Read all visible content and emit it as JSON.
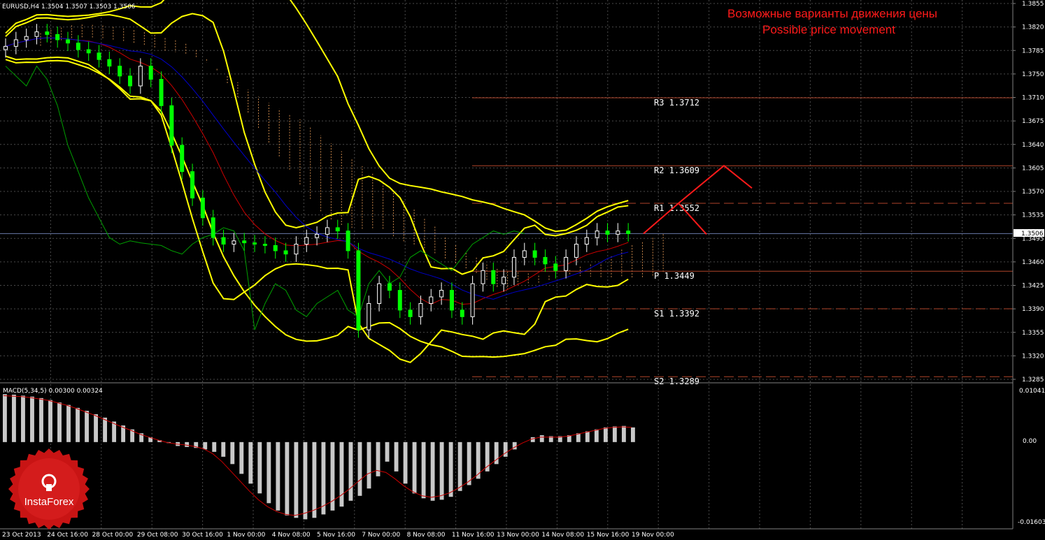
{
  "header": {
    "symbol_info": "EURUSD,H4  1.3504 1.3507 1.3503 1.3506",
    "title_ru": "Возможные варианты движения цены",
    "title_en": "Possible price movement",
    "current_price": "1.3506"
  },
  "macd": {
    "label": "MACD(5,34,5) 0.00300 0.00324",
    "axis_labels": [
      "0.01041",
      "0.00",
      "-0.01603"
    ]
  },
  "logo": {
    "text": "InstaForex"
  },
  "colors": {
    "background": "#000000",
    "grid": "#4a4a4a",
    "bollinger": "#ffff00",
    "kijun": "#cc0000",
    "tenkan": "#0000cc",
    "chikou": "#00a000",
    "cloud": "#c8864a",
    "pivot_lines": "#b0452a",
    "forecast": "#ff1a1a",
    "candle_up": "#ffffff",
    "candle_down": "#00ff00",
    "macd_hist": "#c8c8c8",
    "macd_signal": "#cc0000",
    "current_line": "#6a7aa8"
  },
  "chart_data": {
    "type": "candlestick",
    "instrument": "EURUSD",
    "timeframe": "H4",
    "ylim": [
      1.3285,
      1.3855
    ],
    "y_ticks": [
      "1.3855",
      "1.3820",
      "1.3785",
      "1.3750",
      "1.3710",
      "1.3675",
      "1.3640",
      "1.3605",
      "1.3570",
      "1.3535",
      "1.3495",
      "1.3460",
      "1.3425",
      "1.3390",
      "1.3355",
      "1.3320",
      "1.3285"
    ],
    "x_tick_labels": [
      "23 Oct 2013",
      "24 Oct 16:00",
      "28 Oct 00:00",
      "29 Oct 08:00",
      "30 Oct 16:00",
      "1 Nov 00:00",
      "4 Nov 08:00",
      "5 Nov 16:00",
      "7 Nov 00:00",
      "8 Nov 08:00",
      "11 Nov 16:00",
      "13 Nov 00:00",
      "14 Nov 08:00",
      "15 Nov 16:00",
      "19 Nov 00:00"
    ],
    "pivot_levels": [
      {
        "label": "R3",
        "value": 1.3712,
        "text": "R3 1.3712"
      },
      {
        "label": "R2",
        "value": 1.3609,
        "text": "R2 1.3609"
      },
      {
        "label": "R1",
        "value": 1.3552,
        "text": "R1 1.3552"
      },
      {
        "label": "P",
        "value": 1.3449,
        "text": "P 1.3449"
      },
      {
        "label": "S1",
        "value": 1.3392,
        "text": "S1 1.3392"
      },
      {
        "label": "S2",
        "value": 1.3289,
        "text": "S2 1.3289"
      }
    ],
    "price_closes": [
      1.379,
      1.38,
      1.3805,
      1.3812,
      1.3808,
      1.38,
      1.3795,
      1.3785,
      1.378,
      1.377,
      1.376,
      1.3745,
      1.373,
      1.376,
      1.374,
      1.37,
      1.364,
      1.36,
      1.356,
      1.353,
      1.35,
      1.349,
      1.3495,
      1.3492,
      1.349,
      1.3488,
      1.348,
      1.3475,
      1.349,
      1.35,
      1.3505,
      1.3515,
      1.351,
      1.348,
      1.336,
      1.34,
      1.343,
      1.342,
      1.339,
      1.338,
      1.34,
      1.341,
      1.342,
      1.339,
      1.338,
      1.343,
      1.345,
      1.343,
      1.344,
      1.347,
      1.348,
      1.347,
      1.346,
      1.345,
      1.347,
      1.349,
      1.35,
      1.351,
      1.3505,
      1.351,
      1.3506
    ],
    "forecast_paths": [
      [
        [
          1.3506,
          0
        ],
        [
          1.3552,
          1
        ],
        [
          1.3505,
          2
        ]
      ],
      [
        [
          1.3552,
          1
        ],
        [
          1.3609,
          2
        ],
        [
          1.3575,
          3
        ]
      ]
    ],
    "macd_range": [
      -0.01603,
      0.01041
    ],
    "macd_histogram": [
      0.0098,
      0.0097,
      0.0095,
      0.0093,
      0.009,
      0.0086,
      0.0081,
      0.0076,
      0.007,
      0.0064,
      0.0057,
      0.005,
      0.0042,
      0.0034,
      0.0026,
      0.0018,
      0.001,
      0.0004,
      -0.0002,
      -0.0008,
      -0.001,
      -0.0012,
      -0.0015,
      -0.002,
      -0.003,
      -0.0045,
      -0.0065,
      -0.0085,
      -0.0105,
      -0.0125,
      -0.014,
      -0.015,
      -0.0155,
      -0.0158,
      -0.0155,
      -0.0148,
      -0.014,
      -0.0132,
      -0.012,
      -0.011,
      -0.0095,
      -0.007,
      -0.004,
      -0.006,
      -0.0085,
      -0.0105,
      -0.0115,
      -0.012,
      -0.0118,
      -0.0112,
      -0.01,
      -0.0088,
      -0.0075,
      -0.006,
      -0.0045,
      -0.003,
      -0.0015,
      0.0,
      0.001,
      0.0014,
      0.0012,
      0.0012,
      0.0014,
      0.0018,
      0.0022,
      0.0026,
      0.003,
      0.0032,
      0.0033,
      0.003
    ],
    "macd_signal": [
      0.0095,
      0.0094,
      0.0093,
      0.0091,
      0.0088,
      0.0085,
      0.008,
      0.0075,
      0.0069,
      0.0062,
      0.0055,
      0.0047,
      0.0039,
      0.0031,
      0.0024,
      0.0016,
      0.001,
      0.0004,
      -0.0001,
      -0.0004,
      -0.0006,
      -0.0009,
      -0.0014,
      -0.0024,
      -0.004,
      -0.006,
      -0.008,
      -0.01,
      -0.0118,
      -0.0132,
      -0.0142,
      -0.0148,
      -0.015,
      -0.0146,
      -0.014,
      -0.0132,
      -0.0122,
      -0.011,
      -0.0096,
      -0.008,
      -0.0065,
      -0.0058,
      -0.0062,
      -0.0075,
      -0.009,
      -0.0102,
      -0.011,
      -0.0113,
      -0.011,
      -0.0104,
      -0.0094,
      -0.0082,
      -0.0068,
      -0.0052,
      -0.0038,
      -0.0024,
      -0.0012,
      -0.0002,
      0.0006,
      0.001,
      0.001,
      0.001,
      0.0012,
      0.0016,
      0.002,
      0.0024,
      0.0028,
      0.003,
      0.0031,
      0.003
    ]
  }
}
